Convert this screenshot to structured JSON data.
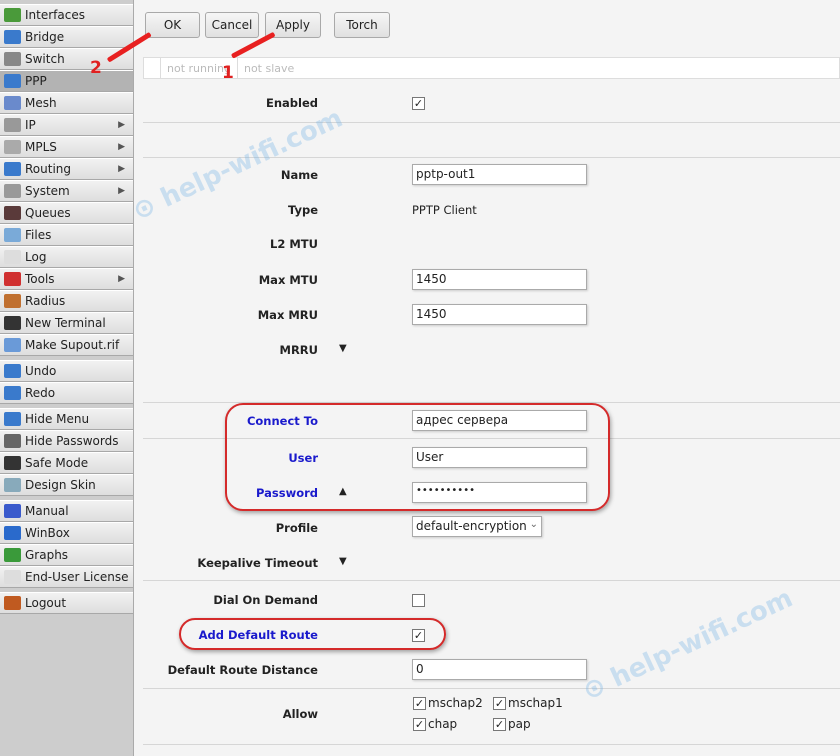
{
  "sidebar": {
    "items": [
      {
        "label": "Interfaces",
        "icon": "interfaces-icon",
        "color": "#4a9a3a"
      },
      {
        "label": "Bridge",
        "icon": "bridge-icon",
        "color": "#3a7acc"
      },
      {
        "label": "Switch",
        "icon": "switch-icon",
        "color": "#888"
      },
      {
        "label": "PPP",
        "icon": "ppp-icon",
        "color": "#3a7acc"
      },
      {
        "label": "Mesh",
        "icon": "mesh-icon",
        "color": "#6a8acc"
      },
      {
        "label": "IP",
        "icon": "ip-icon",
        "color": "#999"
      },
      {
        "label": "MPLS",
        "icon": "mpls-icon",
        "color": "#aaa"
      },
      {
        "label": "Routing",
        "icon": "routing-icon",
        "color": "#3a7acc"
      },
      {
        "label": "System",
        "icon": "system-icon",
        "color": "#999"
      },
      {
        "label": "Queues",
        "icon": "queues-icon",
        "color": "#5a3a3a"
      },
      {
        "label": "Files",
        "icon": "files-icon",
        "color": "#7aaad8"
      },
      {
        "label": "Log",
        "icon": "log-icon",
        "color": "#ddd"
      },
      {
        "label": "Tools",
        "icon": "tools-icon",
        "color": "#d03030"
      },
      {
        "label": "Radius",
        "icon": "radius-icon",
        "color": "#c07030"
      },
      {
        "label": "New Terminal",
        "icon": "terminal-icon",
        "color": "#333"
      },
      {
        "label": "Make Supout.rif",
        "icon": "supout-icon",
        "color": "#6a9ad8"
      },
      {
        "label": "Undo",
        "icon": "undo-icon",
        "color": "#3a7acc"
      },
      {
        "label": "Redo",
        "icon": "redo-icon",
        "color": "#3a7acc"
      },
      {
        "label": "Hide Menu",
        "icon": "hide-menu-icon",
        "color": "#3a7acc"
      },
      {
        "label": "Hide Passwords",
        "icon": "hide-passwords-icon",
        "color": "#666"
      },
      {
        "label": "Safe Mode",
        "icon": "umbrella-icon",
        "color": "#333"
      },
      {
        "label": "Design Skin",
        "icon": "design-skin-icon",
        "color": "#8ab"
      },
      {
        "label": "Manual",
        "icon": "manual-icon",
        "color": "#3a5acc"
      },
      {
        "label": "WinBox",
        "icon": "winbox-icon",
        "color": "#2a6acc"
      },
      {
        "label": "Graphs",
        "icon": "graphs-icon",
        "color": "#3a9a3a"
      },
      {
        "label": "End-User License",
        "icon": "license-icon",
        "color": "#ddd"
      },
      {
        "label": "Logout",
        "icon": "logout-icon",
        "color": "#c05a20"
      }
    ]
  },
  "toolbar": {
    "ok": "OK",
    "cancel": "Cancel",
    "apply": "Apply",
    "torch": "Torch"
  },
  "status": {
    "running": "not running",
    "slave": "not slave"
  },
  "form": {
    "enabled": {
      "label": "Enabled",
      "checked": true
    },
    "name": {
      "label": "Name",
      "value": "pptp-out1"
    },
    "type": {
      "label": "Type",
      "value": "PPTP Client"
    },
    "l2mtu": {
      "label": "L2 MTU"
    },
    "maxmtu": {
      "label": "Max MTU",
      "value": "1450"
    },
    "maxmru": {
      "label": "Max MRU",
      "value": "1450"
    },
    "mrru": {
      "label": "MRRU"
    },
    "connect_to": {
      "label": "Connect To",
      "value": "адрес сервера"
    },
    "user": {
      "label": "User",
      "value": "User"
    },
    "password": {
      "label": "Password",
      "value": "••••••••••"
    },
    "profile": {
      "label": "Profile",
      "value": "default-encryption"
    },
    "keepalive": {
      "label": "Keepalive Timeout"
    },
    "dial": {
      "label": "Dial On Demand",
      "checked": false
    },
    "add_route": {
      "label": "Add Default Route",
      "checked": true
    },
    "route_distance": {
      "label": "Default Route Distance",
      "value": "0"
    },
    "allow": {
      "label": "Allow",
      "options": [
        {
          "label": "mschap2",
          "checked": true
        },
        {
          "label": "mschap1",
          "checked": true
        },
        {
          "label": "chap",
          "checked": true
        },
        {
          "label": "pap",
          "checked": true
        }
      ]
    }
  },
  "annotations": {
    "step1": "1",
    "step2": "2"
  },
  "watermark": "help-wifi.com",
  "accent": "#1a1acc"
}
